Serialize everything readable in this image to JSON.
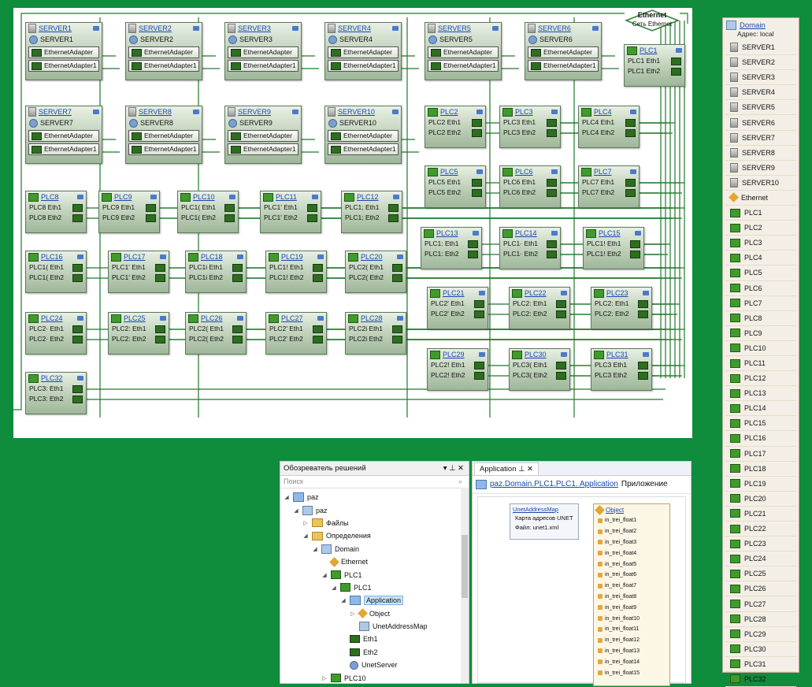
{
  "servers": [
    {
      "name": "SERVER1",
      "adapters": [
        "EthernetAdapter",
        "EthernetAdapter1"
      ]
    },
    {
      "name": "SERVER2",
      "adapters": [
        "EthernetAdapter",
        "EthernetAdapter1"
      ]
    },
    {
      "name": "SERVER3",
      "adapters": [
        "EthernetAdapter",
        "EthernetAdapter1"
      ]
    },
    {
      "name": "SERVER4",
      "adapters": [
        "EthernetAdapter",
        "EthernetAdapter1"
      ]
    },
    {
      "name": "SERVER5",
      "adapters": [
        "EthernetAdapter",
        "EthernetAdapter1"
      ]
    },
    {
      "name": "SERVER6",
      "adapters": [
        "EthernetAdapter",
        "EthernetAdapter1"
      ]
    },
    {
      "name": "SERVER7",
      "adapters": [
        "EthernetAdapter",
        "EthernetAdapter1"
      ]
    },
    {
      "name": "SERVER8",
      "adapters": [
        "EthernetAdapter",
        "EthernetAdapter1"
      ]
    },
    {
      "name": "SERVER9",
      "adapters": [
        "EthernetAdapter",
        "EthernetAdapter1"
      ]
    },
    {
      "name": "SERVER10",
      "adapters": [
        "EthernetAdapter",
        "EthernetAdapter1"
      ]
    }
  ],
  "plcs": [
    {
      "name": "PLC1",
      "rows": [
        "PLC1 Eth1",
        "PLC1 Eth2"
      ]
    },
    {
      "name": "PLC2",
      "rows": [
        "PLC2 Eth1",
        "PLC2 Eth2"
      ]
    },
    {
      "name": "PLC3",
      "rows": [
        "PLC3 Eth1",
        "PLC3 Eth2"
      ]
    },
    {
      "name": "PLC4",
      "rows": [
        "PLC4 Eth1",
        "PLC4 Eth2"
      ]
    },
    {
      "name": "PLC5",
      "rows": [
        "PLC5 Eth1",
        "PLC5 Eth2"
      ]
    },
    {
      "name": "PLC6",
      "rows": [
        "PLC6 Eth1",
        "PLC6 Eth2"
      ]
    },
    {
      "name": "PLC7",
      "rows": [
        "PLC7 Eth1",
        "PLC7 Eth2"
      ]
    },
    {
      "name": "PLC8",
      "rows": [
        "PLC8 Eth1",
        "PLC8 Eth2"
      ]
    },
    {
      "name": "PLC9",
      "rows": [
        "PLC9 Eth1",
        "PLC9 Eth2"
      ]
    },
    {
      "name": "PLC10",
      "rows": [
        "PLC1( Eth1",
        "PLC1( Eth2"
      ]
    },
    {
      "name": "PLC11",
      "rows": [
        "PLC1' Eth1",
        "PLC1' Eth2"
      ]
    },
    {
      "name": "PLC12",
      "rows": [
        "PLC1; Eth1",
        "PLC1; Eth2"
      ]
    },
    {
      "name": "PLC13",
      "rows": [
        "PLC1: Eth1",
        "PLC1: Eth2"
      ]
    },
    {
      "name": "PLC14",
      "rows": [
        "PLC1· Eth1",
        "PLC1· Eth2"
      ]
    },
    {
      "name": "PLC15",
      "rows": [
        "PLC1! Eth1",
        "PLC1! Eth2"
      ]
    },
    {
      "name": "PLC16",
      "rows": [
        "PLC1( Eth1",
        "PLC1( Eth2"
      ]
    },
    {
      "name": "PLC17",
      "rows": [
        "PLC1' Eth1",
        "PLC1' Eth2"
      ]
    },
    {
      "name": "PLC18",
      "rows": [
        "PLC1i Eth1",
        "PLC1i Eth2"
      ]
    },
    {
      "name": "PLC19",
      "rows": [
        "PLC1! Eth1",
        "PLC1! Eth2"
      ]
    },
    {
      "name": "PLC20",
      "rows": [
        "PLC2( Eth1",
        "PLC2( Eth2"
      ]
    },
    {
      "name": "PLC21",
      "rows": [
        "PLC2' Eth1",
        "PLC2' Eth2"
      ]
    },
    {
      "name": "PLC22",
      "rows": [
        "PLC2: Eth1",
        "PLC2: Eth2"
      ]
    },
    {
      "name": "PLC23",
      "rows": [
        "PLC2: Eth1",
        "PLC2: Eth2"
      ]
    },
    {
      "name": "PLC24",
      "rows": [
        "PLC2· Eth1",
        "PLC2· Eth2"
      ]
    },
    {
      "name": "PLC25",
      "rows": [
        "PLC2: Eth1",
        "PLC2: Eth2"
      ]
    },
    {
      "name": "PLC26",
      "rows": [
        "PLC2( Eth1",
        "PLC2( Eth2"
      ]
    },
    {
      "name": "PLC27",
      "rows": [
        "PLC2' Eth1",
        "PLC2' Eth2"
      ]
    },
    {
      "name": "PLC28",
      "rows": [
        "PLC2i Eth1",
        "PLC2i Eth2"
      ]
    },
    {
      "name": "PLC29",
      "rows": [
        "PLC2! Eth1",
        "PLC2! Eth2"
      ]
    },
    {
      "name": "PLC30",
      "rows": [
        "PLC3( Eth1",
        "PLC3( Eth2"
      ]
    },
    {
      "name": "PLC31",
      "rows": [
        "PLC3 Eth1",
        "PLC3 Eth2"
      ]
    },
    {
      "name": "PLC32",
      "rows": [
        "PLC3: Eth1",
        "PLC3: Eth2"
      ]
    }
  ],
  "ethernet": {
    "title": "Ethernet",
    "subtitle": "Сеть Ethernet"
  },
  "domain_panel": {
    "title": "Domain",
    "address": "Адрес: local",
    "items": [
      "SERVER1",
      "SERVER2",
      "SERVER3",
      "SERVER4",
      "SERVER5",
      "SERVER6",
      "SERVER7",
      "SERVER8",
      "SERVER9",
      "SERVER10",
      "Ethernet",
      "PLC1",
      "PLC2",
      "PLC3",
      "PLC4",
      "PLC5",
      "PLC6",
      "PLC7",
      "PLC8",
      "PLC9",
      "PLC10",
      "PLC11",
      "PLC12",
      "PLC13",
      "PLC14",
      "PLC15",
      "PLC16",
      "PLC17",
      "PLC18",
      "PLC19",
      "PLC20",
      "PLC21",
      "PLC22",
      "PLC23",
      "PLC24",
      "PLC25",
      "PLC26",
      "PLC27",
      "PLC28",
      "PLC29",
      "PLC30",
      "PLC31",
      "PLC32"
    ]
  },
  "explorer": {
    "title": "Обозреватель решений",
    "title_controls": "▾ ⊥ ✕",
    "search_placeholder": "Поиск",
    "tree": [
      {
        "label": "paz",
        "arrow": "◢",
        "icon": "solution-icon"
      },
      {
        "label": "paz",
        "arrow": "◢",
        "icon": "project-icon"
      },
      {
        "label": "Файлы",
        "arrow": "▷",
        "icon": "folder-icon"
      },
      {
        "label": "Определения",
        "arrow": "◢",
        "icon": "folder-icon"
      },
      {
        "label": "Domain",
        "arrow": "◢",
        "icon": "domain-icon"
      },
      {
        "label": "Ethernet",
        "arrow": "",
        "icon": "ethernet-icon"
      },
      {
        "label": "PLC1",
        "arrow": "◢",
        "icon": "plc-icon"
      },
      {
        "label": "PLC1",
        "arrow": "◢",
        "icon": "plc-icon"
      },
      {
        "label": "Application",
        "arrow": "◢",
        "icon": "application-icon",
        "selected": true
      },
      {
        "label": "Object",
        "arrow": "▷",
        "icon": "object-icon"
      },
      {
        "label": "UnetAddressMap",
        "arrow": "",
        "icon": "map-icon"
      },
      {
        "label": "Eth1",
        "arrow": "",
        "icon": "eth-icon"
      },
      {
        "label": "Eth2",
        "arrow": "",
        "icon": "eth-icon"
      },
      {
        "label": "UnetServer",
        "arrow": "",
        "icon": "server-gear-icon"
      },
      {
        "label": "PLC10",
        "arrow": "▷",
        "icon": "plc-icon"
      }
    ]
  },
  "app_panel": {
    "tab_label": "Application",
    "tab_controls": "⊥ ✕",
    "crumb_link": "paz.Domain.PLC1.PLC1. Application",
    "crumb_suffix": "Приложение",
    "unet_title": "UnetAddressMap",
    "unet_line1": "Карта адресов UNET",
    "unet_line2": "Файл: unet1.xml",
    "object_title": "Object",
    "object_items": [
      "in_trei_float1",
      "in_trei_float2",
      "in_trei_float3",
      "in_trei_float4",
      "in_trei_float5",
      "in_trei_float6",
      "in_trei_float7",
      "in_trei_float8",
      "in_trei_float9",
      "in_trei_float10",
      "in_trei_float11",
      "in_trei_float12",
      "in_trei_float13",
      "in_trei_float14",
      "in_trei_float15"
    ]
  }
}
